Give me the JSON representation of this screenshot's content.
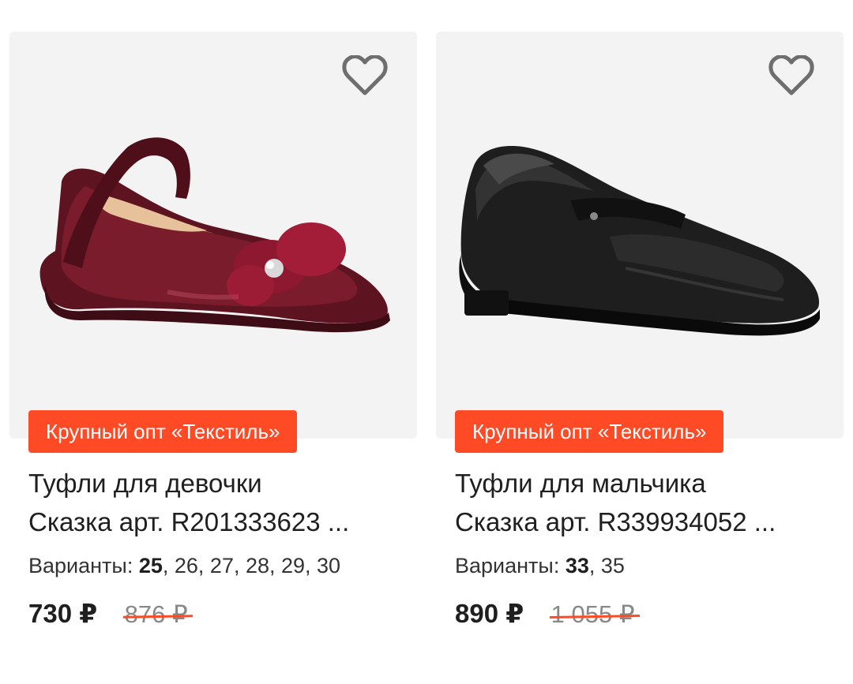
{
  "products": [
    {
      "badge": "Крупный опт «Текстиль»",
      "title_line1": "Туфли для девочки",
      "title_line2": "Сказка арт. R201333623 ...",
      "variants_label": "Варианты:",
      "variants_selected": "25",
      "variants_rest": ", 26, 27, 28, 29, 30",
      "price": "730 ₽",
      "old_price": "876 ₽",
      "image": "burgundy-patent-girls-shoe-with-bow",
      "favorite_icon": "heart-outline-icon"
    },
    {
      "badge": "Крупный опт «Текстиль»",
      "title_line1": "Туфли для мальчика",
      "title_line2": "Сказка арт. R339934052 ...",
      "variants_label": "Варианты:",
      "variants_selected": "33",
      "variants_rest": ", 35",
      "price": "890 ₽",
      "old_price": "1 055 ₽",
      "image": "black-leather-boys-loafer",
      "favorite_icon": "heart-outline-icon"
    }
  ],
  "colors": {
    "badge": "#ff4a26",
    "strike": "#ff4a26",
    "image_bg": "#f3f3f3"
  }
}
